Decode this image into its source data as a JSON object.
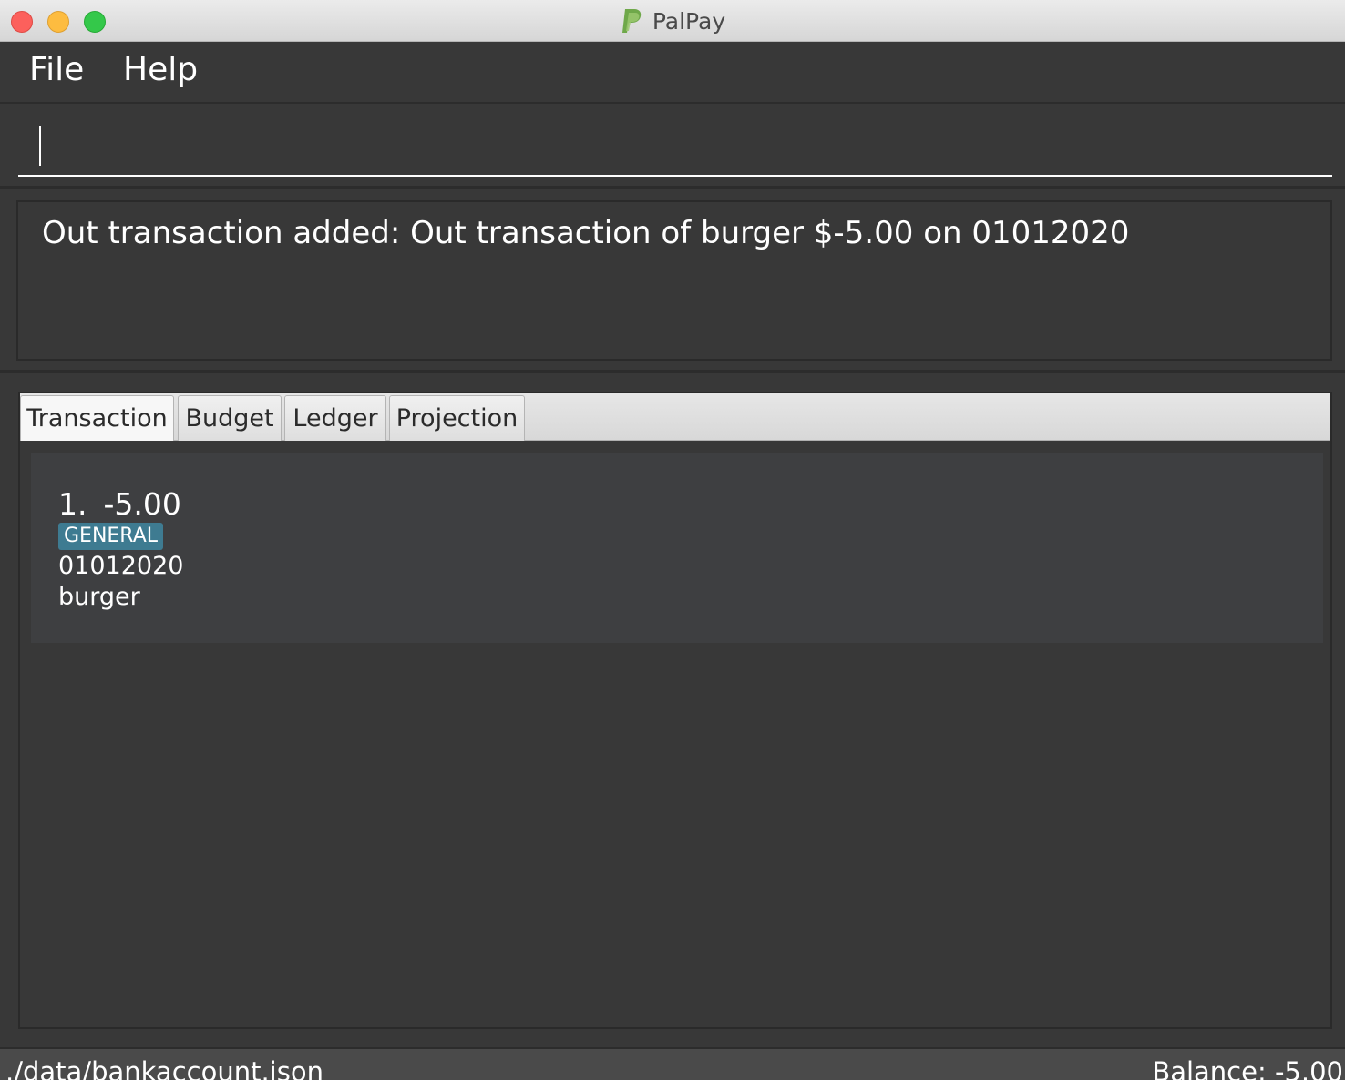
{
  "window": {
    "title": "PalPay",
    "logo_icon": "paypal-logo-icon",
    "controls": {
      "close_color": "#fc605c",
      "minimize_color": "#fdbc40",
      "maximize_color": "#34c84a"
    }
  },
  "menu": {
    "items": [
      {
        "label": "File"
      },
      {
        "label": "Help"
      }
    ]
  },
  "command": {
    "value": "",
    "placeholder": ""
  },
  "result": {
    "message": "Out transaction added: Out transaction of burger $-5.00 on 01012020"
  },
  "tabs": [
    {
      "label": "Transaction",
      "active": true
    },
    {
      "label": "Budget",
      "active": false
    },
    {
      "label": "Ledger",
      "active": false
    },
    {
      "label": "Projection",
      "active": false
    }
  ],
  "transactions": [
    {
      "index": "1.",
      "amount": "-5.00",
      "category": "GENERAL",
      "date": "01012020",
      "description": "burger"
    }
  ],
  "status": {
    "file_path": "./data/bankaccount.json",
    "balance": "Balance: -5.00"
  },
  "colors": {
    "background": "#383838",
    "card": "#3e3f41",
    "badge": "#3e7b91",
    "text": "#ffffff"
  }
}
